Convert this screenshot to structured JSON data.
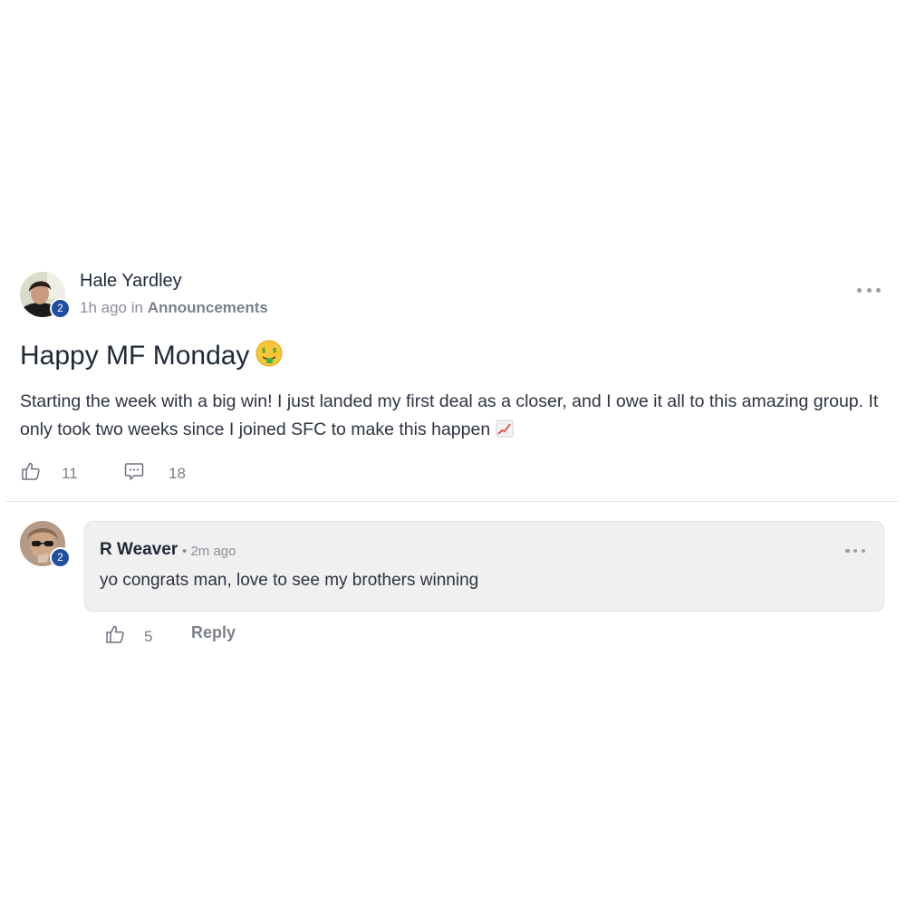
{
  "post": {
    "author": "Hale Yardley",
    "author_level": "2",
    "time_ago": "1h ago",
    "in_word": "in",
    "category": "Announcements",
    "title": "Happy MF Monday",
    "title_emoji": "money-mouth-face",
    "body": "Starting the week with a big win! I just landed my first deal as a closer, and I owe it all to this amazing group. It only took two weeks since I joined SFC to make this happen",
    "body_emoji": "chart-increasing",
    "like_count": "11",
    "comment_count": "18"
  },
  "comment": {
    "author": "R Weaver",
    "author_level": "2",
    "time_ago": "2m ago",
    "separator": "•",
    "text": "yo congrats man, love to see my brothers winning",
    "like_count": "5",
    "reply_label": "Reply"
  },
  "colors": {
    "badge": "#1e4fa0",
    "bubble_bg": "#f0f0f1",
    "muted_text": "#8a8f98",
    "primary_text": "#1f2937"
  },
  "icons": {
    "like": "thumbs-up-outline-icon",
    "comment": "chat-bubble-dots-icon",
    "more": "ellipsis-horizontal-icon"
  }
}
